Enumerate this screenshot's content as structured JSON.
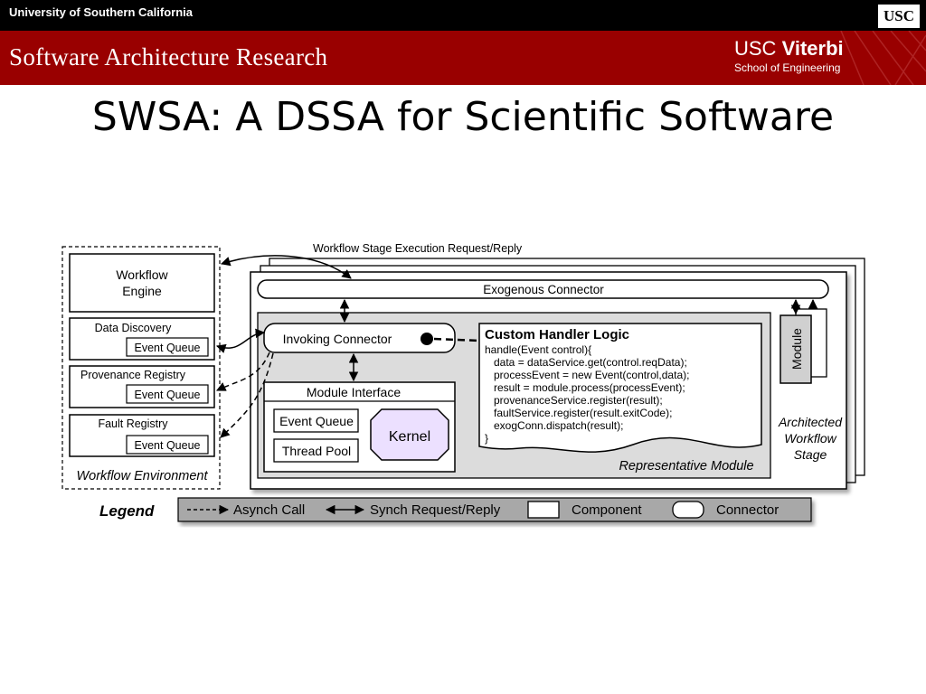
{
  "header": {
    "university": "University of Southern California",
    "usc_logo": "USC",
    "lab_name": "Software Architecture Research",
    "school_brand_a": "USC",
    "school_brand_b": "Viterbi",
    "school_name": "School of Engineering"
  },
  "slide": {
    "title": "SWSA:  A DSSA for Scientific Software"
  },
  "diagram": {
    "top_label": "Workflow Stage Execution Request/Reply",
    "environment": {
      "label": "Workflow Environment",
      "workflow_engine": [
        "Workflow",
        "Engine"
      ],
      "data_discovery": "Data Discovery",
      "provenance_registry": "Provenance Registry",
      "fault_registry": "Fault Registry",
      "event_queue": "Event Queue"
    },
    "exogenous_connector": "Exogenous Connector",
    "invoking_connector": "Invoking Connector",
    "module_interface": "Module Interface",
    "event_queue": "Event Queue",
    "thread_pool": "Thread Pool",
    "kernel": "Kernel",
    "module": "Module",
    "representative_module": "Representative Module",
    "architected_stage": [
      "Architected",
      "Workflow",
      "Stage"
    ],
    "handler": {
      "title": "Custom Handler Logic",
      "lines": [
        "handle(Event control){",
        "data = dataService.get(control.reqData);",
        "processEvent = new Event(control,data);",
        "result = module.process(processEvent);",
        "provenanceService.register(result);",
        "faultService.register(result.exitCode);",
        "exogConn.dispatch(result);",
        "}"
      ]
    },
    "legend": {
      "title": "Legend",
      "async": "Asynch Call",
      "sync": "Synch Request/Reply",
      "component": "Component",
      "connector": "Connector"
    }
  },
  "colors": {
    "header_red": "#990000",
    "kernel_fill": "#ece0ff",
    "panel_gray": "#dcdcdc",
    "legend_gray": "#a8a8a8"
  }
}
